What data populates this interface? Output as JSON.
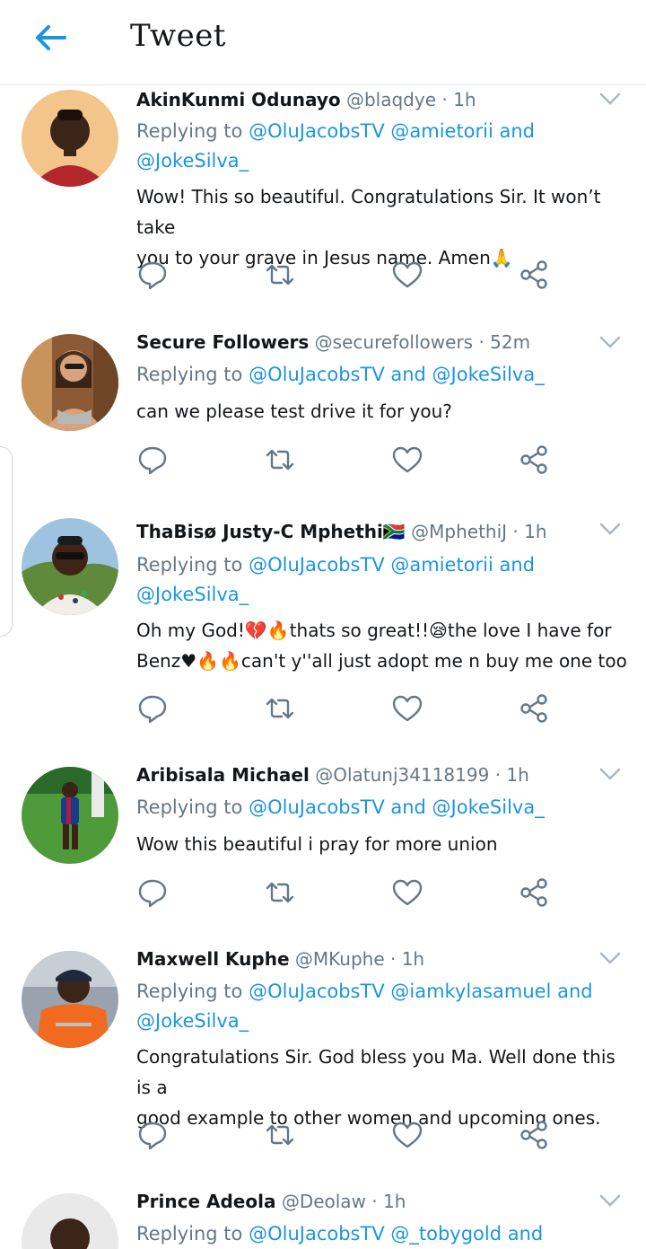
{
  "header": {
    "title": "Tweet"
  },
  "tweets": [
    {
      "name": "AkinKunmi Odunayo",
      "handle": "@blaqdye",
      "time": "· 1h",
      "replying_prefix": "Replying to",
      "line1": "@OluJacobsTV @amietorii and",
      "line2": "@JokeSilva_",
      "body1": "Wow! This so beautiful. Congratulations Sir. It won’t take",
      "body2": "you to your grave in Jesus name. Amen🙏"
    },
    {
      "name": "Secure Followers",
      "handle": "@securefollowers",
      "time": "· 52m",
      "replying_prefix": "Replying to",
      "line1": "@OluJacobsTV and @JokeSilva_",
      "body1": "can we please test drive it for you?"
    },
    {
      "name": "ThaBisø Justy-C Mphethi🇿🇦",
      "handle": "@MphethiJ",
      "time": "· 1h",
      "replying_prefix": "Replying to",
      "line1": "@OluJacobsTV @amietorii and",
      "line2": "@JokeSilva_",
      "body1": "Oh my God!💔🔥thats so great!!😪the love I have for",
      "body2": "Benz♥🔥🔥can't y''all just adopt me n buy me one too"
    },
    {
      "name": "Aribisala Michael",
      "handle": "@Olatunj34118199",
      "time": "· 1h",
      "replying_prefix": "Replying to",
      "line1": "@OluJacobsTV and @JokeSilva_",
      "body1": "Wow this beautiful i pray for more union"
    },
    {
      "name": "Maxwell Kuphe",
      "handle": "@MKuphe",
      "time": "· 1h",
      "replying_prefix": "Replying to",
      "line1": "@OluJacobsTV @iamkylasamuel and",
      "line2": "@JokeSilva_",
      "body1": "Congratulations Sir. God bless you Ma. Well done this is a",
      "body2": "good example to other women and upcoming ones."
    },
    {
      "name": "Prince Adeola",
      "handle": "@Deolaw",
      "time": "· 1h",
      "replying_prefix": "Replying to",
      "line1": "@OluJacobsTV @_tobygold and"
    }
  ],
  "colors": {
    "link": "#1b95e0",
    "muted": "#657786",
    "text": "#14171a",
    "icon": "#657786",
    "divider": "#e1e8ed"
  },
  "icons": [
    "back-arrow-icon",
    "reply-icon",
    "retweet-icon",
    "like-icon",
    "share-icon",
    "chevron-down-icon"
  ]
}
